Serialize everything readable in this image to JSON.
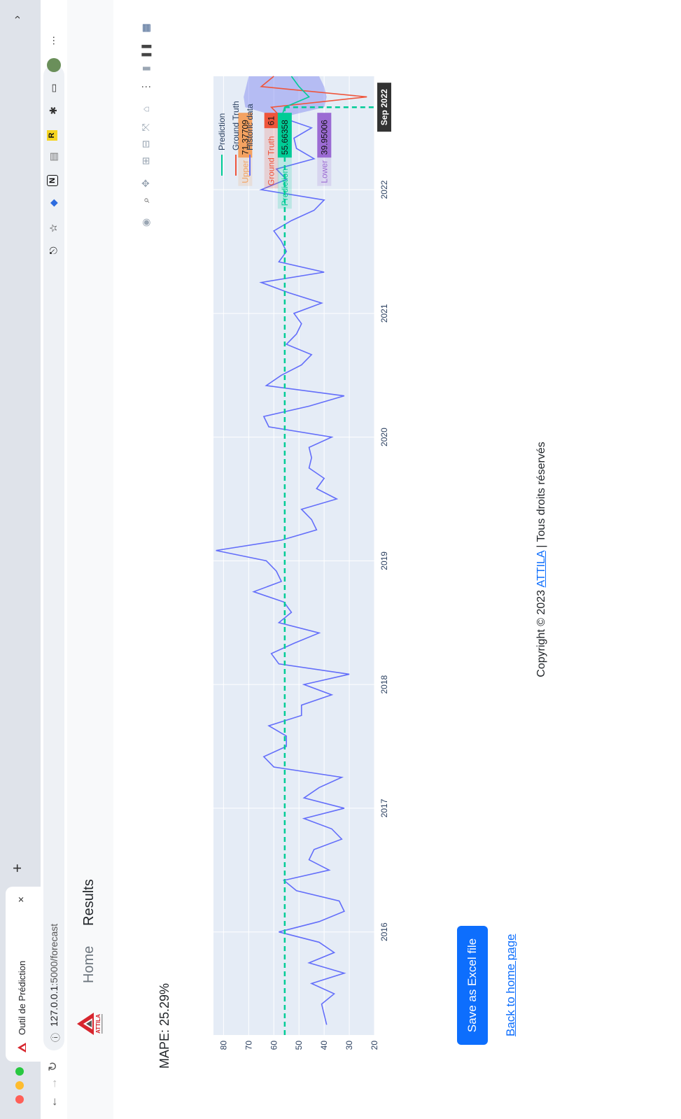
{
  "browser": {
    "tab_title": "Outil de Prédiction",
    "url_host": "127.0.0.1",
    "url_path": ":5000/forecast",
    "new_tab_symbol": "+",
    "close_symbol": "×",
    "menu_symbol": "⋯",
    "chevron_symbol": "›"
  },
  "nav": {
    "home": "Home",
    "results": "Results"
  },
  "main": {
    "mape": "MAPE: 25.29%",
    "save_button": "Save as Excel file",
    "back_link": "Back to home page"
  },
  "footer": {
    "prefix": "Copyright © 2023 ",
    "brand": "ATTILA",
    "suffix": " | Tous droits réservés"
  },
  "colors": {
    "historic": "#636efa",
    "prediction": "#00cc96",
    "ground_truth": "#ef553b",
    "band": "#7b82f0",
    "plot_bg": "#e5ecf6",
    "button": "#0d6efd"
  },
  "chart_data": {
    "type": "line",
    "x_ticks": [
      "2016",
      "2017",
      "2018",
      "2019",
      "2020",
      "2021",
      "2022"
    ],
    "y_ticks": [
      20,
      30,
      40,
      50,
      60,
      70,
      80
    ],
    "ylim": [
      20,
      84
    ],
    "xlim": [
      "2015-03",
      "2022-12"
    ],
    "legend": [
      "Prediction",
      "Ground Truth",
      "Historic data"
    ],
    "legend_position": "top-right",
    "series": [
      {
        "name": "Historic data",
        "x": [
          "2015-04",
          "2015-05",
          "2015-06",
          "2015-07",
          "2015-08",
          "2015-09",
          "2015-10",
          "2015-11",
          "2015-12",
          "2016-01",
          "2016-02",
          "2016-03",
          "2016-04",
          "2016-05",
          "2016-06",
          "2016-07",
          "2016-08",
          "2016-09",
          "2016-10",
          "2016-11",
          "2016-12",
          "2017-01",
          "2017-02",
          "2017-03",
          "2017-04",
          "2017-05",
          "2017-06",
          "2017-07",
          "2017-08",
          "2017-09",
          "2017-10",
          "2017-11",
          "2017-12",
          "2018-01",
          "2018-02",
          "2018-03",
          "2018-04",
          "2018-05",
          "2018-06",
          "2018-07",
          "2018-08",
          "2018-09",
          "2018-10",
          "2018-11",
          "2018-12",
          "2019-01",
          "2019-02",
          "2019-03",
          "2019-04",
          "2019-05",
          "2019-06",
          "2019-07",
          "2019-08",
          "2019-09",
          "2019-10",
          "2019-11",
          "2019-12",
          "2020-01",
          "2020-02",
          "2020-03",
          "2020-04",
          "2020-05",
          "2020-06",
          "2020-07",
          "2020-08",
          "2020-09",
          "2020-10",
          "2020-11",
          "2020-12",
          "2021-01",
          "2021-02",
          "2021-03",
          "2021-04",
          "2021-05",
          "2021-06",
          "2021-07",
          "2021-08",
          "2021-09",
          "2021-10",
          "2021-11",
          "2021-12",
          "2022-01",
          "2022-02",
          "2022-03",
          "2022-04",
          "2022-05",
          "2022-06",
          "2022-07",
          "2022-08"
        ],
        "values": [
          39,
          40,
          41,
          36,
          45,
          32,
          46,
          36,
          42,
          58,
          42,
          32,
          34,
          51,
          56,
          38,
          46,
          44,
          33,
          37,
          48,
          32,
          48,
          42,
          33,
          60,
          64,
          55,
          55,
          62,
          49,
          49,
          37,
          48,
          30,
          58,
          61,
          52,
          42,
          58,
          53,
          56,
          68,
          57,
          59,
          63,
          83,
          57,
          43,
          45,
          49,
          35,
          43,
          40,
          46,
          45,
          46,
          37,
          62,
          64,
          46,
          32,
          63,
          57,
          49,
          45,
          55,
          51,
          49,
          52,
          41,
          54,
          65,
          40,
          58,
          55,
          57,
          60,
          53,
          44,
          40,
          65,
          55,
          59,
          44,
          51,
          52,
          45,
          57
        ]
      },
      {
        "name": "Prediction",
        "x": [
          "2022-08",
          "2022-09",
          "2022-10",
          "2022-11",
          "2022-12"
        ],
        "values": [
          57,
          55.66,
          46,
          50,
          53
        ]
      },
      {
        "name": "Ground Truth",
        "x": [
          "2022-08",
          "2022-09",
          "2022-10",
          "2022-11",
          "2022-12"
        ],
        "values": [
          57,
          61,
          23,
          65,
          60
        ]
      },
      {
        "name": "Upper",
        "x": [
          "2022-08",
          "2022-09",
          "2022-10",
          "2022-11",
          "2022-12"
        ],
        "values": [
          57,
          71.37709,
          72,
          71,
          70
        ]
      },
      {
        "name": "Lower",
        "x": [
          "2022-08",
          "2022-09",
          "2022-10",
          "2022-11",
          "2022-12"
        ],
        "values": [
          57,
          39.95006,
          39,
          40,
          42
        ]
      }
    ],
    "hover": {
      "x_label": "Sep 2022",
      "reference_line_y": 55.66358,
      "labels": [
        {
          "value": "71.37709",
          "name": "Upper"
        },
        {
          "value": "61",
          "name": "Ground Truth"
        },
        {
          "value": "55.66358",
          "name": "Prediction"
        },
        {
          "value": "39.95006",
          "name": "Lower"
        }
      ]
    }
  }
}
